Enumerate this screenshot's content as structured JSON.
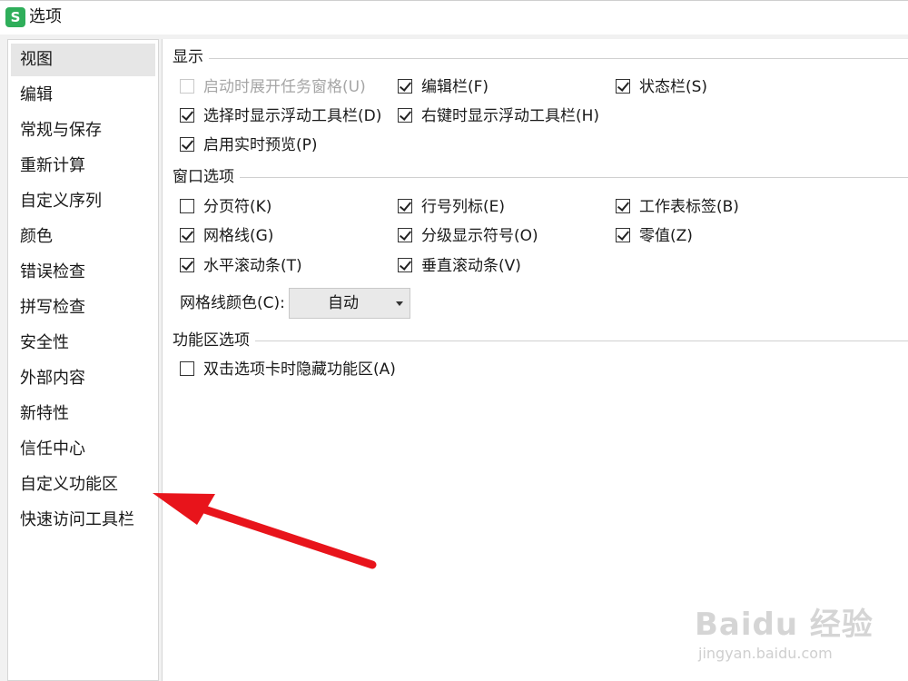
{
  "window": {
    "title": "选项",
    "app_icon_letter": "S"
  },
  "sidebar": {
    "items": [
      {
        "label": "视图",
        "selected": true
      },
      {
        "label": "编辑"
      },
      {
        "label": "常规与保存"
      },
      {
        "label": "重新计算"
      },
      {
        "label": "自定义序列"
      },
      {
        "label": "颜色"
      },
      {
        "label": "错误检查"
      },
      {
        "label": "拼写检查"
      },
      {
        "label": "安全性"
      },
      {
        "label": "外部内容"
      },
      {
        "label": "新特性"
      },
      {
        "label": "信任中心"
      },
      {
        "label": "自定义功能区"
      },
      {
        "label": "快速访问工具栏"
      }
    ]
  },
  "display": {
    "title": "显示",
    "options": [
      {
        "label": "启动时展开任务窗格(U)",
        "checked": false,
        "disabled": true
      },
      {
        "label": "编辑栏(F)",
        "checked": true
      },
      {
        "label": "状态栏(S)",
        "checked": true
      },
      {
        "label": "选择时显示浮动工具栏(D)",
        "checked": true
      },
      {
        "label": "右键时显示浮动工具栏(H)",
        "checked": true
      },
      {
        "label": "启用实时预览(P)",
        "checked": true
      }
    ]
  },
  "window_options": {
    "title": "窗口选项",
    "options": [
      {
        "label": "分页符(K)",
        "checked": false
      },
      {
        "label": "行号列标(E)",
        "checked": true
      },
      {
        "label": "工作表标签(B)",
        "checked": true
      },
      {
        "label": "网格线(G)",
        "checked": true
      },
      {
        "label": "分级显示符号(O)",
        "checked": true
      },
      {
        "label": "零值(Z)",
        "checked": true
      },
      {
        "label": "水平滚动条(T)",
        "checked": true
      },
      {
        "label": "垂直滚动条(V)",
        "checked": true
      }
    ],
    "gridline_color_label": "网格线颜色(C):",
    "gridline_color_value": "自动"
  },
  "ribbon_options": {
    "title": "功能区选项",
    "options": [
      {
        "label": "双击选项卡时隐藏功能区(A)",
        "checked": false
      }
    ]
  },
  "annotation": {
    "arrow_color": "#e8141b",
    "points_to": "自定义功能区"
  },
  "watermark": {
    "brand": "Baidu 经验",
    "url": "jingyan.baidu.com"
  }
}
